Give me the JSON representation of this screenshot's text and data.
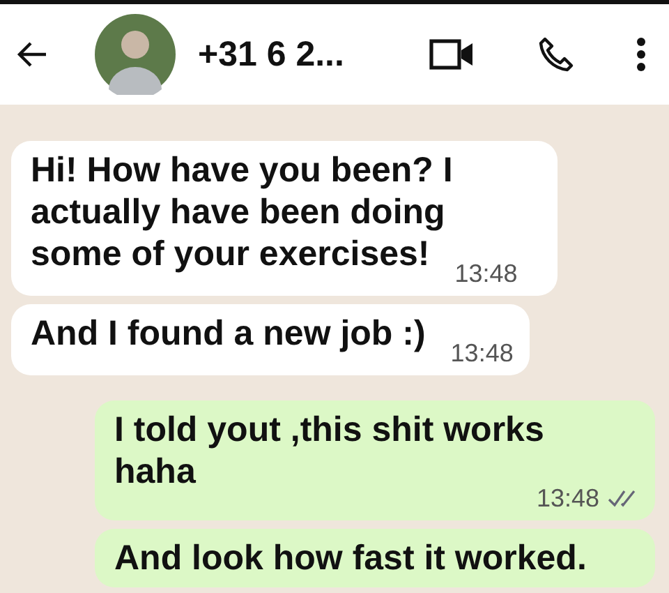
{
  "header": {
    "contact_name": "+31 6 2..."
  },
  "messages": [
    {
      "kind": "incoming",
      "text": "Hi! How have you been? I actually have been doing some of your exercises!",
      "time": "13:48"
    },
    {
      "kind": "incoming",
      "text": "And I found a new job :)",
      "time": "13:48"
    },
    {
      "kind": "outgoing",
      "text": "I told yout ,this shit works haha",
      "time": "13:48",
      "read": false
    },
    {
      "kind": "outgoing",
      "text": "And look how fast it worked."
    }
  ]
}
